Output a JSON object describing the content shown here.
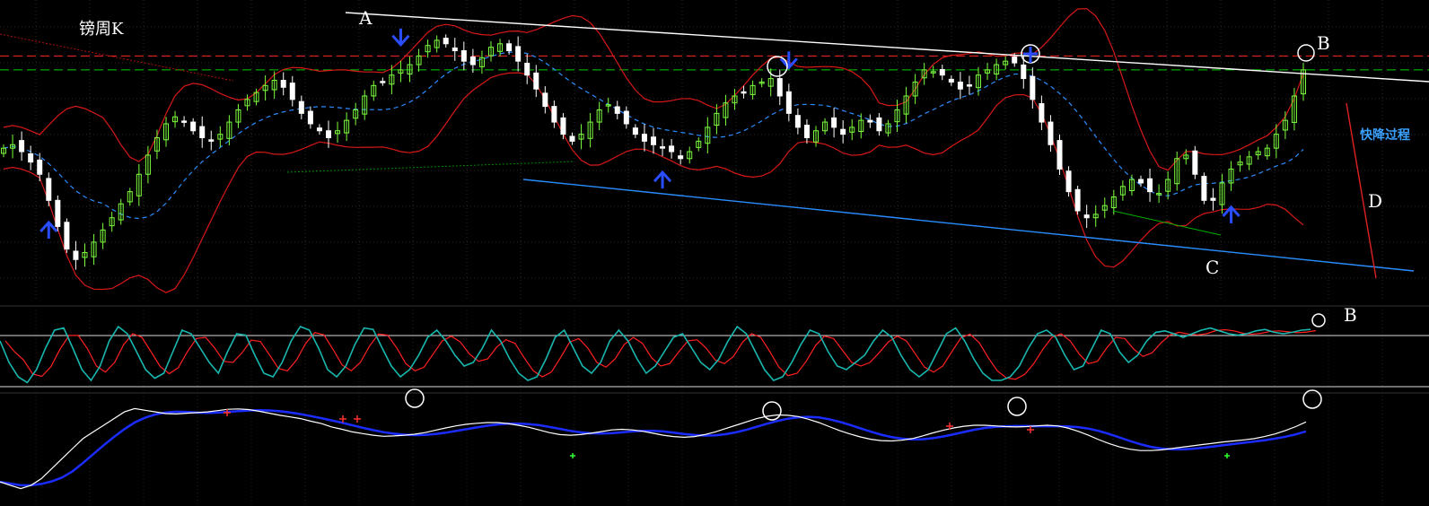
{
  "chart_data": {
    "type": "candlestick",
    "title": "镑周K",
    "annotations": {
      "a": "A",
      "b": "B",
      "c": "C",
      "d": "D",
      "fast_drop": "快降过程",
      "b_osc": "B"
    },
    "colors": {
      "up": "#7cff3c",
      "down": "#ffffff",
      "boll": "#d81818",
      "mid": "#2a8dff",
      "trend_top": "#ffffff",
      "trend_bottom": "#2a8dff",
      "res_red": "#ff2a2a",
      "sup_green": "#00d000",
      "osc_k": "#18b8b0",
      "osc_d": "#ff2020",
      "macd_w": "#ffffff",
      "macd_b": "#1a2cff",
      "arrow": "#2a4dff"
    },
    "candle_count": 145,
    "close": [
      1.63,
      1.632,
      1.628,
      1.622,
      1.615,
      1.6,
      1.585,
      1.572,
      1.566,
      1.57,
      1.576,
      1.583,
      1.59,
      1.598,
      1.605,
      1.615,
      1.626,
      1.636,
      1.644,
      1.648,
      1.645,
      1.64,
      1.636,
      1.634,
      1.638,
      1.645,
      1.652,
      1.658,
      1.662,
      1.666,
      1.669,
      1.665,
      1.658,
      1.65,
      1.644,
      1.64,
      1.636,
      1.64,
      1.646,
      1.652,
      1.66,
      1.666,
      1.668,
      1.672,
      1.675,
      1.678,
      1.683,
      1.689,
      1.692,
      1.69,
      1.686,
      1.68,
      1.678,
      1.682,
      1.688,
      1.69,
      1.686,
      1.68,
      1.672,
      1.664,
      1.654,
      1.645,
      1.638,
      1.634,
      1.638,
      1.645,
      1.652,
      1.655,
      1.65,
      1.644,
      1.638,
      1.634,
      1.632,
      1.63,
      1.628,
      1.624,
      1.628,
      1.634,
      1.642,
      1.65,
      1.656,
      1.66,
      1.662,
      1.666,
      1.668,
      1.67,
      1.66,
      1.65,
      1.642,
      1.636,
      1.64,
      1.645,
      1.642,
      1.638,
      1.642,
      1.646,
      1.645,
      1.64,
      1.644,
      1.652,
      1.66,
      1.668,
      1.675,
      1.674,
      1.672,
      1.668,
      1.664,
      1.666,
      1.672,
      1.675,
      1.678,
      1.68,
      1.679,
      1.67,
      1.658,
      1.645,
      1.632,
      1.618,
      1.605,
      1.594,
      1.59,
      1.592,
      1.597,
      1.602,
      1.608,
      1.612,
      1.61,
      1.605,
      1.604,
      1.612,
      1.624,
      1.626,
      1.615,
      1.6,
      1.6,
      1.61,
      1.618,
      1.622,
      1.625,
      1.628,
      1.63,
      1.638,
      1.646,
      1.66,
      1.675
    ],
    "y_range": [
      1.545,
      1.71
    ],
    "levels": [
      1.683,
      1.675
    ],
    "oscillator_k": [
      70,
      40,
      20,
      12,
      30,
      60,
      85,
      88,
      60,
      30,
      15,
      35,
      70,
      90,
      80,
      55,
      30,
      18,
      25,
      55,
      85,
      80,
      60,
      40,
      25,
      55,
      80,
      78,
      50,
      25,
      20,
      40,
      70,
      90,
      85,
      60,
      30,
      20,
      35,
      65,
      88,
      86,
      60,
      35,
      20,
      30,
      50,
      75,
      85,
      70,
      50,
      35,
      40,
      60,
      85,
      70,
      45,
      25,
      15,
      20,
      45,
      75,
      85,
      60,
      35,
      25,
      40,
      70,
      85,
      70,
      45,
      25,
      35,
      55,
      75,
      80,
      60,
      40,
      30,
      45,
      70,
      90,
      80,
      55,
      30,
      15,
      20,
      40,
      65,
      85,
      80,
      55,
      35,
      30,
      40,
      50,
      70,
      85,
      75,
      50,
      30,
      20,
      30,
      55,
      80,
      88,
      70,
      45,
      25,
      15,
      15,
      20,
      35,
      60,
      80,
      85,
      75,
      50,
      30,
      35,
      60,
      85,
      80,
      55,
      40,
      50,
      70,
      82,
      84,
      80,
      75,
      80,
      85,
      88,
      84,
      80,
      78,
      80,
      84,
      86,
      82,
      80,
      82,
      85,
      86
    ],
    "oscillator_d_lag": 2,
    "macd_line": [
      -0.012,
      -0.013,
      -0.014,
      -0.013,
      -0.011,
      -0.008,
      -0.005,
      -0.002,
      0.001,
      0.003,
      0.005,
      0.007,
      0.009,
      0.01,
      0.0095,
      0.009,
      0.0085,
      0.0084,
      0.0086,
      0.0088,
      0.009,
      0.0094,
      0.0098,
      0.0099,
      0.0097,
      0.0092,
      0.0086,
      0.008,
      0.0075,
      0.007,
      0.0062,
      0.0055,
      0.0045,
      0.0038,
      0.003,
      0.0025,
      0.002,
      0.0017,
      0.0018,
      0.002,
      0.0023,
      0.0028,
      0.0035,
      0.0042,
      0.0048,
      0.0053,
      0.0056,
      0.0058,
      0.0058,
      0.0055,
      0.005,
      0.0044,
      0.0036,
      0.0028,
      0.0022,
      0.002,
      0.0022,
      0.0026,
      0.0031,
      0.0036,
      0.0038,
      0.0036,
      0.0032,
      0.0026,
      0.002,
      0.0016,
      0.0014,
      0.0016,
      0.0022,
      0.003,
      0.004,
      0.005,
      0.006,
      0.007,
      0.0077,
      0.0081,
      0.008,
      0.0076,
      0.0068,
      0.0058,
      0.0046,
      0.0034,
      0.0024,
      0.0015,
      0.0008,
      0.0004,
      0.0003,
      0.0005,
      0.001,
      0.0018,
      0.0027,
      0.0035,
      0.0042,
      0.0047,
      0.005,
      0.005,
      0.0048,
      0.0046,
      0.0045,
      0.0046,
      0.0048,
      0.005,
      0.0048,
      0.0042,
      0.0032,
      0.002,
      0.0007,
      -0.0005,
      -0.0015,
      -0.0022,
      -0.0026,
      -0.0026,
      -0.0024,
      -0.002,
      -0.0016,
      -0.0012,
      -0.0008,
      -0.0004,
      0.0,
      0.0003,
      0.0006,
      0.001,
      0.0016,
      0.0024,
      0.0034,
      0.0046,
      0.006
    ],
    "macd_x_offset": 14,
    "macd_signal_lag": 5,
    "markers": {
      "arrows_up": [
        8,
        118,
        219
      ],
      "arrows_down": [
        71,
        140
      ],
      "circle_arrow": 183,
      "circles_price": [
        138
      ],
      "circles_osc": [
        145
      ],
      "circles_macd": [
        73,
        138,
        181,
        233
      ],
      "red_plus_macd": [
        40,
        60,
        63,
        169,
        183
      ],
      "green_plus_macd": [
        102,
        219
      ]
    }
  }
}
